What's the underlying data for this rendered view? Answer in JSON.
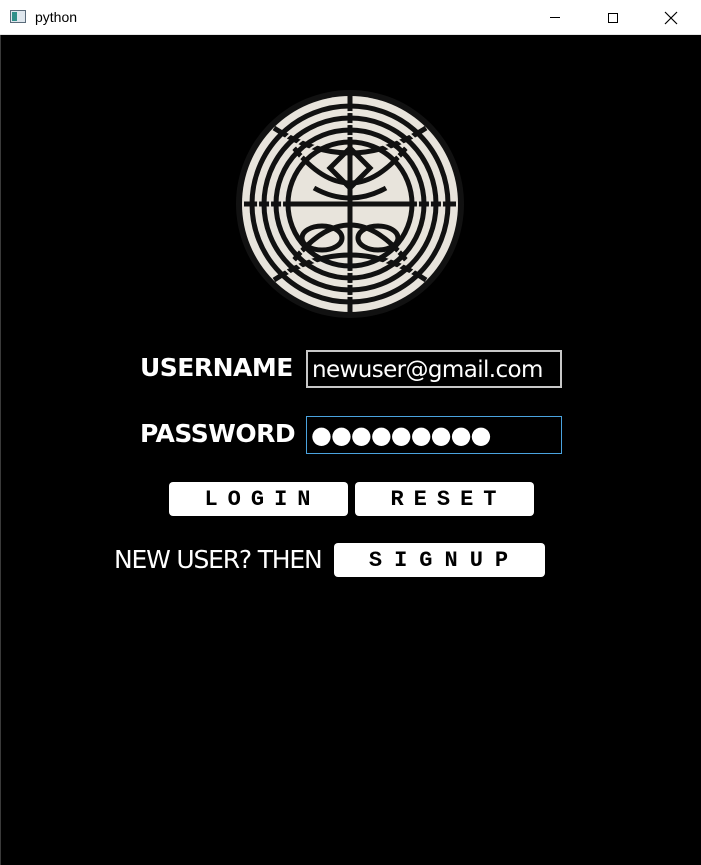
{
  "window": {
    "title": "python",
    "controls": {
      "minimize_icon": "minimize-icon",
      "maximize_icon": "maximize-icon",
      "close_icon": "close-icon"
    }
  },
  "logo": {
    "icon": "celtic-knot-emblem"
  },
  "form": {
    "username_label": "USERNAME",
    "username_value": "newuser@gmail.com",
    "password_label": "PASSWORD",
    "password_masked": "●●●●●●●●●"
  },
  "buttons": {
    "login_label": "LOGIN",
    "reset_label": "RESET",
    "signup_label": "SIGNUP"
  },
  "signup_prompt": "NEW USER? THEN",
  "colors": {
    "background": "#000000",
    "text": "#ffffff",
    "focus_border": "#4aa3df"
  }
}
